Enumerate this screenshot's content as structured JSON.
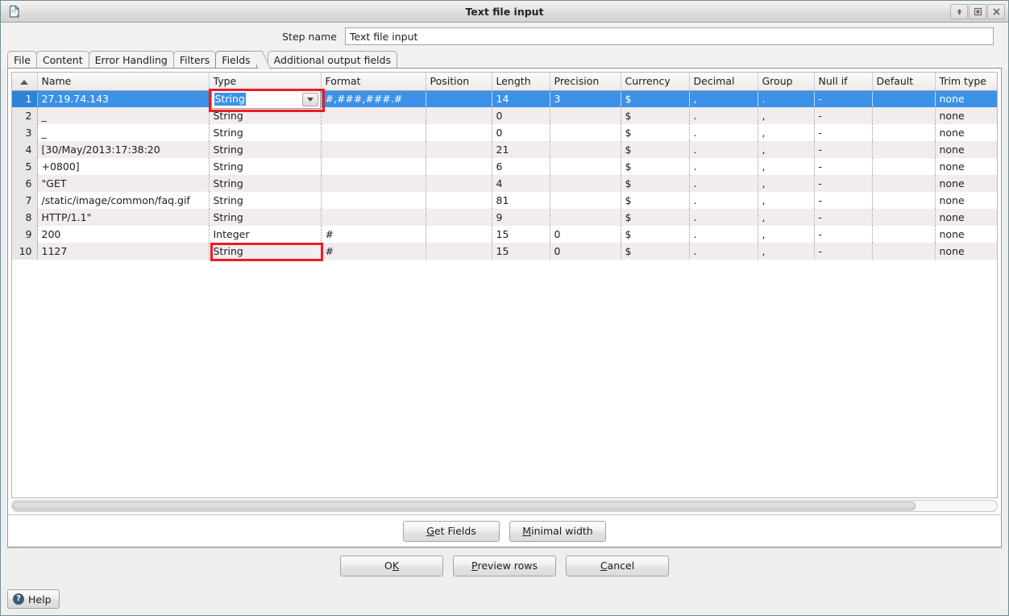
{
  "window": {
    "title": "Text file input",
    "icon": "file-document-icon",
    "controls": [
      {
        "name": "rollup-button",
        "glyph": "arrow-up-icon"
      },
      {
        "name": "maximize-button",
        "glyph": "maximize-icon"
      },
      {
        "name": "close-button",
        "glyph": "close-icon"
      }
    ]
  },
  "step": {
    "label": "Step name",
    "value": "Text file input",
    "placeholder": ""
  },
  "tabs": [
    {
      "label": "File",
      "selected": false
    },
    {
      "label": "Content",
      "selected": false
    },
    {
      "label": "Error Handling",
      "selected": false
    },
    {
      "label": "Filters",
      "selected": false
    },
    {
      "label": "Fields",
      "selected": true
    },
    {
      "label": "Additional output fields",
      "selected": false
    }
  ],
  "grid": {
    "columns": [
      {
        "key": "num",
        "label": "",
        "sorted": true
      },
      {
        "key": "name",
        "label": "Name"
      },
      {
        "key": "type",
        "label": "Type"
      },
      {
        "key": "format",
        "label": "Format"
      },
      {
        "key": "position",
        "label": "Position"
      },
      {
        "key": "length",
        "label": "Length"
      },
      {
        "key": "precision",
        "label": "Precision"
      },
      {
        "key": "currency",
        "label": "Currency"
      },
      {
        "key": "decimal",
        "label": "Decimal"
      },
      {
        "key": "group",
        "label": "Group"
      },
      {
        "key": "nullif",
        "label": "Null if"
      },
      {
        "key": "default",
        "label": "Default"
      },
      {
        "key": "trim",
        "label": "Trim type"
      }
    ],
    "rows": [
      {
        "num": "1",
        "name": "27.19.74.143",
        "type": "String",
        "format": "#,###,###.#",
        "position": "",
        "length": "14",
        "precision": "3",
        "currency": "$",
        "decimal": ",",
        "group": ".",
        "nullif": "-",
        "default": "",
        "trim": "none",
        "selected": true,
        "editing": true
      },
      {
        "num": "2",
        "name": "_",
        "type": "String",
        "format": "",
        "position": "",
        "length": "0",
        "precision": "",
        "currency": "$",
        "decimal": ".",
        "group": ",",
        "nullif": "-",
        "default": "",
        "trim": "none",
        "selected": false,
        "editing": false
      },
      {
        "num": "3",
        "name": "_",
        "type": "String",
        "format": "",
        "position": "",
        "length": "0",
        "precision": "",
        "currency": "$",
        "decimal": ".",
        "group": ",",
        "nullif": "-",
        "default": "",
        "trim": "none",
        "selected": false,
        "editing": false
      },
      {
        "num": "4",
        "name": "[30/May/2013:17:38:20",
        "type": "String",
        "format": "",
        "position": "",
        "length": "21",
        "precision": "",
        "currency": "$",
        "decimal": ".",
        "group": ",",
        "nullif": "-",
        "default": "",
        "trim": "none",
        "selected": false,
        "editing": false
      },
      {
        "num": "5",
        "name": "+0800]",
        "type": "String",
        "format": "",
        "position": "",
        "length": "6",
        "precision": "",
        "currency": "$",
        "decimal": ".",
        "group": ",",
        "nullif": "-",
        "default": "",
        "trim": "none",
        "selected": false,
        "editing": false
      },
      {
        "num": "6",
        "name": "\"GET",
        "type": "String",
        "format": "",
        "position": "",
        "length": "4",
        "precision": "",
        "currency": "$",
        "decimal": ".",
        "group": ",",
        "nullif": "-",
        "default": "",
        "trim": "none",
        "selected": false,
        "editing": false
      },
      {
        "num": "7",
        "name": "/static/image/common/faq.gif",
        "type": "String",
        "format": "",
        "position": "",
        "length": "81",
        "precision": "",
        "currency": "$",
        "decimal": ".",
        "group": ",",
        "nullif": "-",
        "default": "",
        "trim": "none",
        "selected": false,
        "editing": false
      },
      {
        "num": "8",
        "name": "HTTP/1.1\"",
        "type": "String",
        "format": "",
        "position": "",
        "length": "9",
        "precision": "",
        "currency": "$",
        "decimal": ".",
        "group": ",",
        "nullif": "-",
        "default": "",
        "trim": "none",
        "selected": false,
        "editing": false
      },
      {
        "num": "9",
        "name": "200",
        "type": "Integer",
        "format": "#",
        "position": "",
        "length": "15",
        "precision": "0",
        "currency": "$",
        "decimal": ".",
        "group": ",",
        "nullif": "-",
        "default": "",
        "trim": "none",
        "selected": false,
        "editing": false
      },
      {
        "num": "10",
        "name": "1127",
        "type": "String",
        "format": "#",
        "position": "",
        "length": "15",
        "precision": "0",
        "currency": "$",
        "decimal": ".",
        "group": ",",
        "nullif": "-",
        "default": "",
        "trim": "none",
        "selected": false,
        "editing": false,
        "annotated": true
      }
    ]
  },
  "annotations": {
    "color": "#ec1c24",
    "boxes": [
      {
        "name": "type-combo-highlight",
        "target": "row-1-type-combobox"
      },
      {
        "name": "type-value-highlight",
        "target": "row-10-type-cell"
      }
    ]
  },
  "buttons": {
    "get_fields": {
      "mnemonic": "G",
      "rest": "et Fields"
    },
    "minimal_width": {
      "mnemonic": "M",
      "rest": "inimal width"
    },
    "ok": {
      "pre": "O",
      "mnemonic": "K",
      "rest": ""
    },
    "preview_rows": {
      "mnemonic": "P",
      "rest": "review rows"
    },
    "cancel": {
      "mnemonic": "C",
      "rest": "ancel"
    },
    "help": {
      "label": "Help",
      "icon": "question-mark-icon"
    }
  },
  "scrollbar": {
    "orientation": "horizontal",
    "thumb_percent": 92
  }
}
